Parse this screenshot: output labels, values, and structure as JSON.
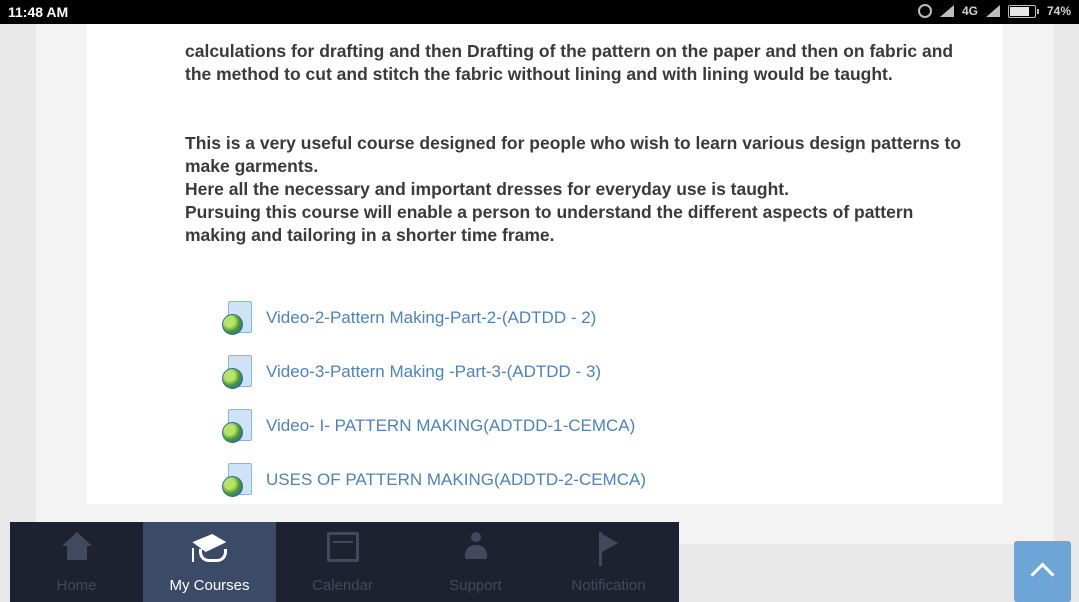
{
  "status_bar": {
    "time": "11:48 AM",
    "network": "4G",
    "battery": "74%"
  },
  "content": {
    "paragraph1": "calculations for drafting and then Drafting of the pattern on the paper and then on fabric and the method to cut and stitch the fabric without lining and with lining would be taught.",
    "paragraph2_line1": "This is a very useful course designed for people who wish to learn various design patterns to make garments.",
    "paragraph2_line2": "Here all the necessary and important dresses for everyday use is taught.",
    "paragraph2_line3": "Pursuing this course will enable a person to understand the different aspects of pattern making and tailoring in a shorter time frame."
  },
  "resources": [
    {
      "label": "Video-2-Pattern Making-Part-2-(ADTDD - 2)",
      "icon": "web-resource-icon"
    },
    {
      "label": "Video-3-Pattern Making -Part-3-(ADTDD - 3)",
      "icon": "web-resource-icon"
    },
    {
      "label": "Video- I- PATTERN MAKING(ADTDD-1-CEMCA)",
      "icon": "web-resource-icon"
    },
    {
      "label": "USES OF PATTERN MAKING(ADDTD-2-CEMCA)",
      "icon": "web-resource-icon"
    }
  ],
  "bottom_nav": {
    "items": [
      {
        "label": "Home",
        "icon": "home-icon",
        "active": false
      },
      {
        "label": "My Courses",
        "icon": "graduation-cap-icon",
        "active": true
      },
      {
        "label": "Calendar",
        "icon": "calendar-icon",
        "active": false
      },
      {
        "label": "Support",
        "icon": "person-icon",
        "active": false
      },
      {
        "label": "Notification",
        "icon": "flag-icon",
        "active": false
      }
    ]
  },
  "colors": {
    "link": "#4f83b5",
    "nav_bg": "#1e2230",
    "nav_active": "#3b4a66",
    "scroll_top_button": "#6ca5d6"
  }
}
